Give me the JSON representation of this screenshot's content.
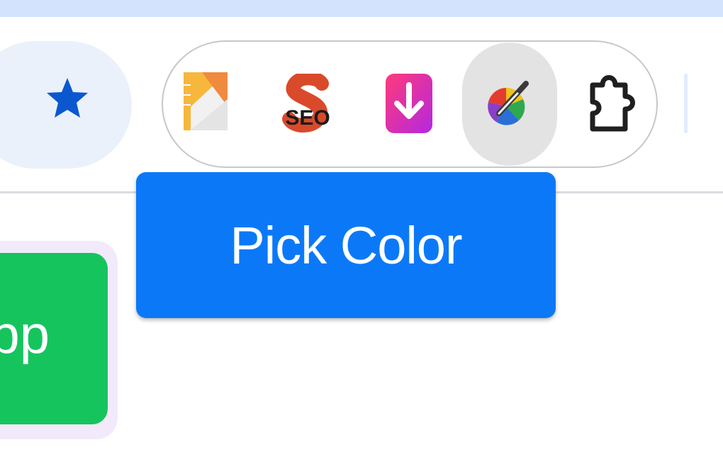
{
  "toolbar": {
    "bookmark_icon": "star-icon",
    "extensions": [
      {
        "icon": "ruler-extension-icon"
      },
      {
        "icon": "seo-extension-icon",
        "label": "SEO"
      },
      {
        "icon": "download-extension-icon"
      },
      {
        "icon": "color-picker-extension-icon",
        "state": "hovered"
      },
      {
        "icon": "puzzle-extensions-icon"
      }
    ]
  },
  "tooltip": {
    "text": "Pick Color"
  },
  "page": {
    "button_text": "pp"
  },
  "colors": {
    "tabstrip": "#d3e3fd",
    "star": "#0b57d0",
    "tooltip_bg": "#0b79f7",
    "page_button": "#16c45e"
  }
}
